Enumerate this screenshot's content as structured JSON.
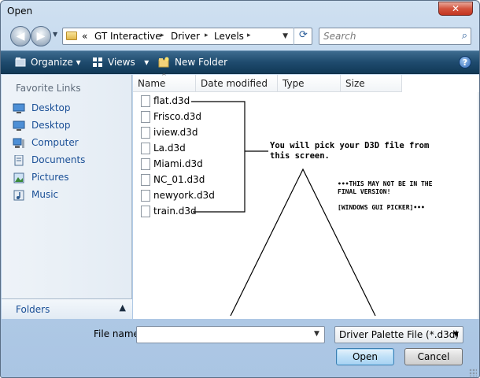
{
  "window": {
    "title": "Open",
    "close_glyph": "✕"
  },
  "nav": {
    "back_glyph": "◀",
    "forward_glyph": "▶",
    "breadcrumb_prefix": "«",
    "breadcrumb": [
      "GT Interactive",
      "Driver",
      "Levels"
    ],
    "separator": "▸",
    "refresh_glyph": "⟳"
  },
  "search": {
    "placeholder": "Search",
    "icon": "search-icon"
  },
  "toolbar": {
    "organize_label": "Organize",
    "views_label": "Views",
    "new_folder_label": "New Folder",
    "help_label": "?"
  },
  "sidebar": {
    "title": "Favorite Links",
    "items": [
      {
        "label": "Desktop",
        "icon": "desktop-icon"
      },
      {
        "label": "Desktop",
        "icon": "desktop-icon"
      },
      {
        "label": "Computer",
        "icon": "computer-icon"
      },
      {
        "label": "Documents",
        "icon": "documents-icon"
      },
      {
        "label": "Pictures",
        "icon": "pictures-icon"
      },
      {
        "label": "Music",
        "icon": "music-icon"
      }
    ],
    "folders_label": "Folders"
  },
  "columns": [
    "Name",
    "Date modified",
    "Type",
    "Size"
  ],
  "files": [
    "flat.d3d",
    "Frisco.d3d",
    "iview.d3d",
    "La.d3d",
    "Miami.d3d",
    "NC_01.d3d",
    "newyork.d3d",
    "train.d3d"
  ],
  "annotation": {
    "main": "You will pick your D3D file from\nthis screen.",
    "note": "•••THIS MAY NOT BE IN THE\nFINAL VERSION!\n\n[WINDOWS GUI PICKER]•••"
  },
  "bottom": {
    "file_name_label": "File name:",
    "file_name_value": "",
    "file_type_value": "Driver Palette File (*.d3d)",
    "open_label": "Open",
    "cancel_label": "Cancel"
  },
  "colors": {
    "link": "#1a4f96",
    "toolbar": "#1f4b6e",
    "close": "#c23420"
  }
}
